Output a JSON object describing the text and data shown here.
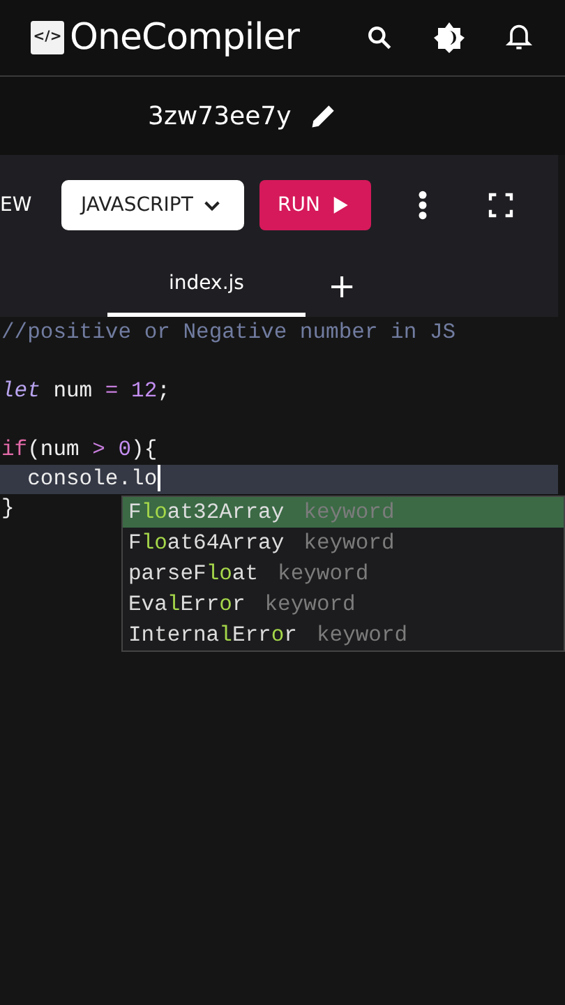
{
  "header": {
    "logo_mark": "</>",
    "brand": "OneCompiler"
  },
  "file_name": "3zw73ee7y",
  "toolbar": {
    "cut_label": "EW",
    "language": "JAVASCRIPT",
    "run": "RUN"
  },
  "tabs": [
    {
      "label": "index.js",
      "selected": true
    },
    {
      "label": "+",
      "selected": false
    }
  ],
  "code": {
    "lines": [
      {
        "kind": "code",
        "current": false,
        "tokens": [
          {
            "kind": "comment",
            "text": "//positive or Negative number in JS"
          }
        ]
      },
      {
        "kind": "blank"
      },
      {
        "kind": "code",
        "current": false,
        "tokens": [
          {
            "kind": "keyword",
            "text": "let"
          },
          {
            "kind": "plain",
            "text": " num "
          },
          {
            "kind": "operator",
            "text": "= "
          },
          {
            "kind": "number",
            "text": "12"
          },
          {
            "kind": "plain",
            "text": ";"
          }
        ]
      },
      {
        "kind": "blank"
      },
      {
        "kind": "code",
        "current": false,
        "tokens": [
          {
            "kind": "control",
            "text": "if"
          },
          {
            "kind": "plain",
            "text": "(num "
          },
          {
            "kind": "operator",
            "text": "> "
          },
          {
            "kind": "number",
            "text": "0"
          },
          {
            "kind": "plain",
            "text": "){"
          }
        ]
      },
      {
        "kind": "code",
        "current": true,
        "tokens": [
          {
            "kind": "plain",
            "text": "  console.lo"
          }
        ]
      },
      {
        "kind": "code",
        "current": false,
        "tokens": [
          {
            "kind": "plain",
            "text": "}"
          }
        ]
      }
    ]
  },
  "suggestions": [
    {
      "selected": true,
      "type": "keyword",
      "parts": [
        {
          "text": "F",
          "match": false
        },
        {
          "text": "lo",
          "match": true
        },
        {
          "text": "at32Array",
          "match": false
        }
      ]
    },
    {
      "selected": false,
      "type": "keyword",
      "parts": [
        {
          "text": "F",
          "match": false
        },
        {
          "text": "lo",
          "match": true
        },
        {
          "text": "at64Array",
          "match": false
        }
      ]
    },
    {
      "selected": false,
      "type": "keyword",
      "parts": [
        {
          "text": "parseF",
          "match": false
        },
        {
          "text": "lo",
          "match": true
        },
        {
          "text": "at",
          "match": false
        }
      ]
    },
    {
      "selected": false,
      "type": "keyword",
      "parts": [
        {
          "text": "Eva",
          "match": false
        },
        {
          "text": "l",
          "match": true
        },
        {
          "text": "Err",
          "match": false
        },
        {
          "text": "o",
          "match": true
        },
        {
          "text": "r",
          "match": false
        }
      ]
    },
    {
      "selected": false,
      "type": "keyword",
      "parts": [
        {
          "text": "Interna",
          "match": false
        },
        {
          "text": "l",
          "match": true
        },
        {
          "text": "Err",
          "match": false
        },
        {
          "text": "o",
          "match": true
        },
        {
          "text": "r",
          "match": false
        }
      ]
    }
  ]
}
